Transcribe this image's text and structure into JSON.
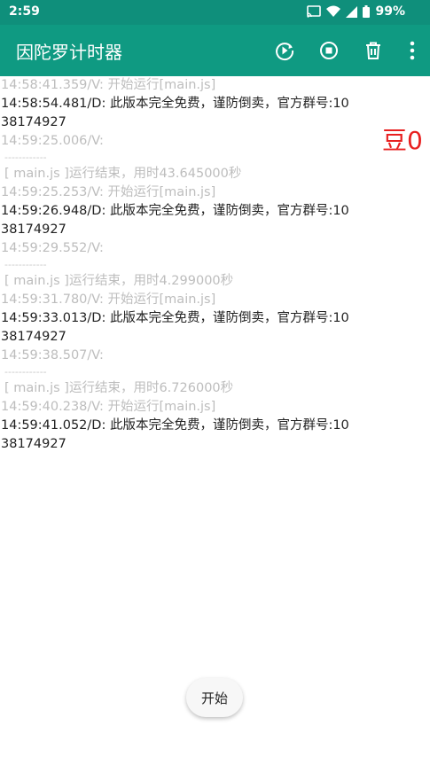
{
  "status_bar": {
    "time": "2:59",
    "battery": "99%",
    "icons": [
      "cast-icon",
      "wifi-icon",
      "signal-icon",
      "battery-icon"
    ]
  },
  "app_bar": {
    "title": "因陀罗计时器",
    "actions": [
      "run-icon",
      "stop-icon",
      "delete-icon",
      "more-vert-icon"
    ],
    "background": "#0f9a82"
  },
  "overlay": {
    "text": "豆0",
    "color": "#e82020"
  },
  "log": [
    {
      "type": "v",
      "text": "14:58:41.359/V: 开始运行[main.js]"
    },
    {
      "type": "d",
      "text": "14:58:54.481/D: 此版本完全免费，谨防倒卖，官方群号:1038174927"
    },
    {
      "type": "v",
      "text": "14:59:25.006/V:"
    },
    {
      "type": "sep",
      "text": "------------"
    },
    {
      "type": "end",
      "text": "[ main.js ]运行结束，用时43.645000秒"
    },
    {
      "type": "v",
      "text": "14:59:25.253/V: 开始运行[main.js]"
    },
    {
      "type": "d",
      "text": "14:59:26.948/D: 此版本完全免费，谨防倒卖，官方群号:1038174927"
    },
    {
      "type": "v",
      "text": "14:59:29.552/V:"
    },
    {
      "type": "sep",
      "text": "------------"
    },
    {
      "type": "end",
      "text": "[ main.js ]运行结束，用时4.299000秒"
    },
    {
      "type": "v",
      "text": "14:59:31.780/V: 开始运行[main.js]"
    },
    {
      "type": "d",
      "text": "14:59:33.013/D: 此版本完全免费，谨防倒卖，官方群号:1038174927"
    },
    {
      "type": "v",
      "text": "14:59:38.507/V:"
    },
    {
      "type": "sep",
      "text": "------------"
    },
    {
      "type": "end",
      "text": "[ main.js ]运行结束，用时6.726000秒"
    },
    {
      "type": "v",
      "text": "14:59:40.238/V: 开始运行[main.js]"
    },
    {
      "type": "d",
      "text": "14:59:41.052/D: 此版本完全免费，谨防倒卖，官方群号:1038174927"
    }
  ],
  "start_button": {
    "label": "开始"
  }
}
